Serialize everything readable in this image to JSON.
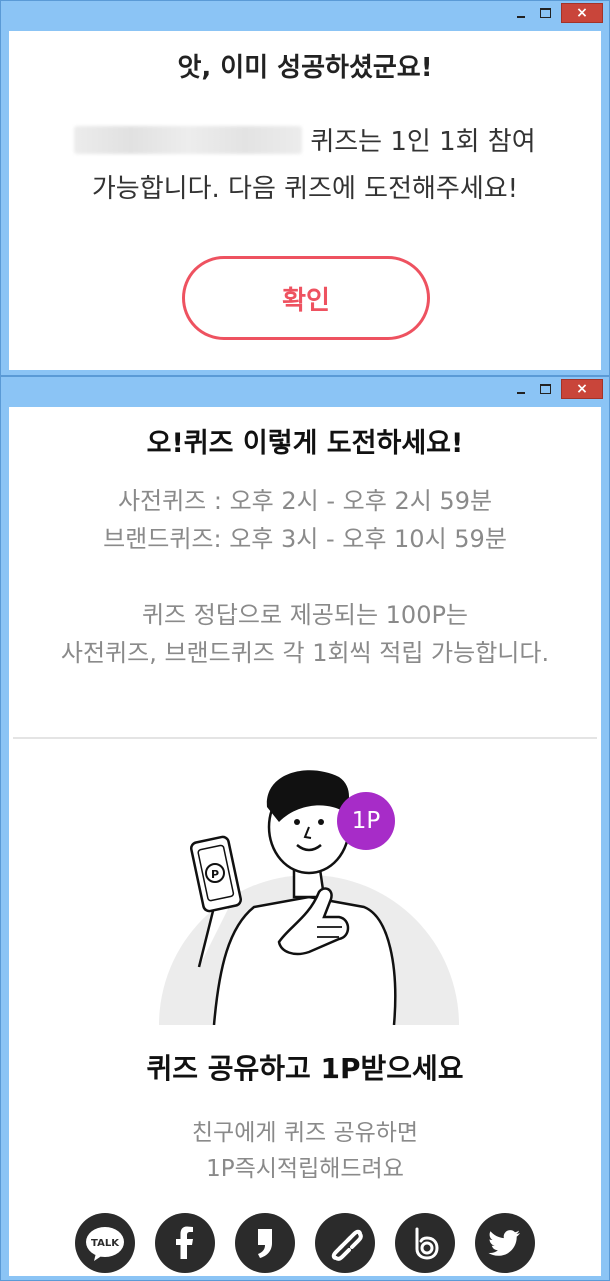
{
  "dialog1": {
    "title": "앗, 이미 성공하셨군요!",
    "message_line1": "퀴즈는 1인 1회 참여",
    "message_line2": "가능합니다. 다음 퀴즈에 도전해주세요!",
    "confirm_label": "확인"
  },
  "dialog2": {
    "title": "오!퀴즈 이렇게 도전하세요!",
    "schedule": [
      "사전퀴즈 : 오후 2시 - 오후 2시 59분",
      "브랜드퀴즈: 오후 3시 - 오후 10시 59분"
    ],
    "notice": [
      "퀴즈 정답으로 제공되는 100P는",
      "사전퀴즈, 브랜드퀴즈 각 1회씩 적립 가능합니다."
    ],
    "badge": "1P",
    "share_title": "퀴즈 공유하고 1P받으세요",
    "share_sub": [
      "친구에게 퀴즈 공유하면",
      "1P즉시적립해드려요"
    ],
    "social_buttons": [
      {
        "icon": "kakaotalk-icon",
        "label": "TALK"
      },
      {
        "icon": "facebook-icon"
      },
      {
        "icon": "kakaostory-icon"
      },
      {
        "icon": "link-icon"
      },
      {
        "icon": "band-icon"
      },
      {
        "icon": "twitter-icon"
      }
    ]
  },
  "window_controls": {
    "minimize": "",
    "maximize": "",
    "close": "×"
  },
  "colors": {
    "titlebar": "#8bc4f5",
    "close_button": "#c9453a",
    "accent_red": "#ee5260",
    "badge_purple": "#a72cc8",
    "social_bg": "#2b2b2b",
    "muted_text": "#8a8a8a"
  }
}
